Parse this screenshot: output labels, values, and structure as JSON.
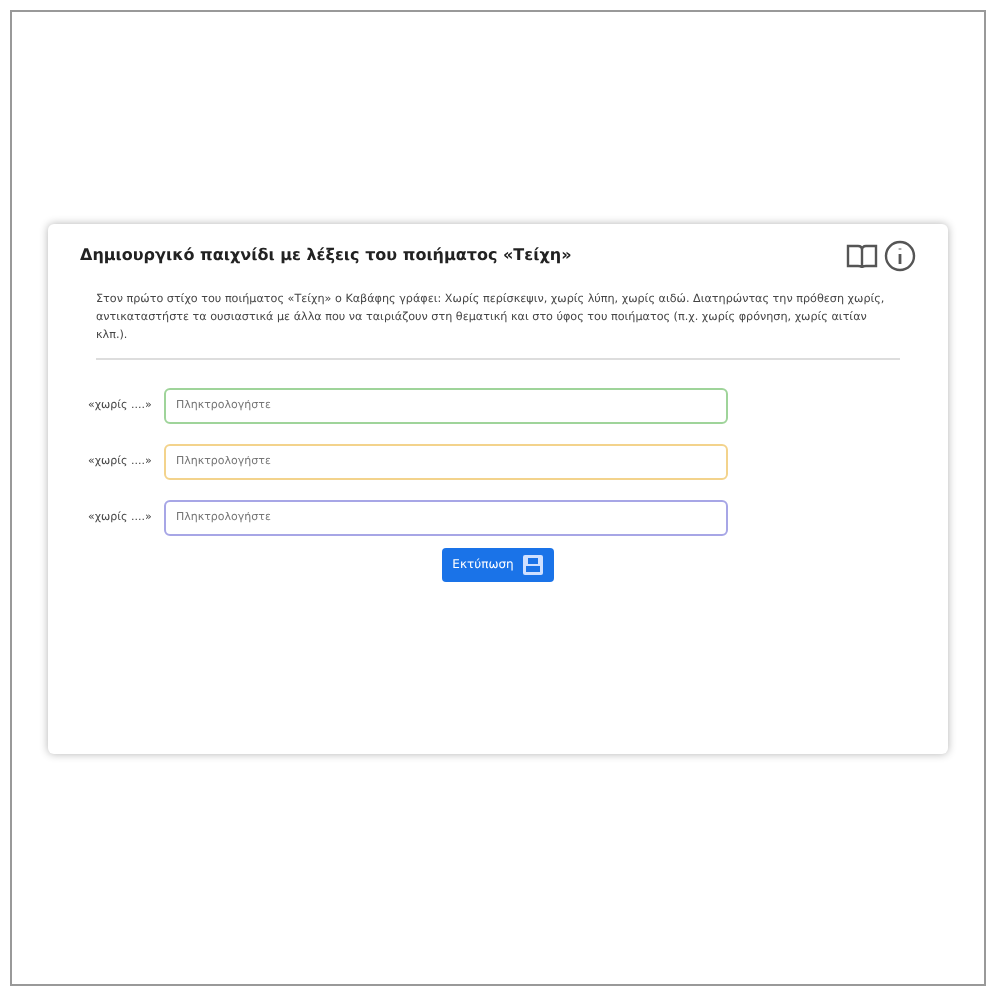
{
  "card": {
    "title": "Δημιουργικό παιχνίδι με λέξεις του ποιήματος «Τείχη»",
    "instructions": "Στον πρώτο στίχο του ποιήματος «Τείχη» ο Καβάφης γράφει: Χωρίς περίσκεψιν, χωρίς λύπη, χωρίς αιδώ. Διατηρώντας την πρόθεση χωρίς, αντικαταστήστε τα ουσιαστικά με άλλα που να ταιριάζουν στη θεματική και στο ύφος του ποιήματος (π.χ. χωρίς φρόνηση, χωρίς αιτίαν κλπ.).",
    "rows": [
      {
        "label": "«χωρίς ....»",
        "placeholder": "Πληκτρολογήστε",
        "color": "#9fd49a"
      },
      {
        "label": "«χωρίς ....»",
        "placeholder": "Πληκτρολογήστε",
        "color": "#f3d38c"
      },
      {
        "label": "«χωρίς ....»",
        "placeholder": "Πληκτρολογήστε",
        "color": "#a7a6e6"
      }
    ],
    "button": "Εκτύπωση"
  }
}
